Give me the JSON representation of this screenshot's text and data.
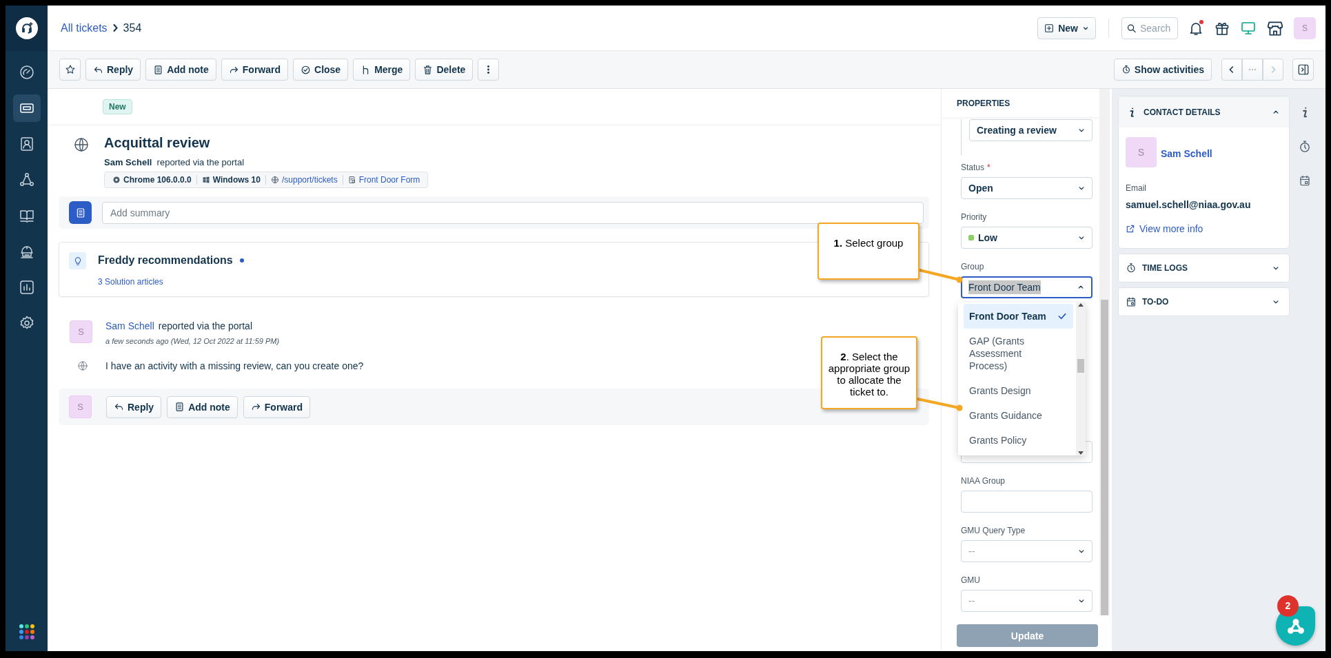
{
  "sidebar": {
    "items": [
      {
        "selected": false
      },
      {
        "selected": true
      },
      {
        "selected": false
      },
      {
        "selected": false
      },
      {
        "selected": false
      },
      {
        "selected": false
      },
      {
        "selected": false
      },
      {
        "selected": false
      }
    ]
  },
  "header": {
    "breadcrumb_link": "All tickets",
    "breadcrumb_current": "354",
    "new_button": "New",
    "search_placeholder": "Search",
    "notifications_unread": true,
    "avatar": "S"
  },
  "toolbar": {
    "buttons": [
      "Reply",
      "Add note",
      "Forward",
      "Close",
      "Merge",
      "Delete"
    ],
    "show_activities": "Show activities"
  },
  "ticket": {
    "status_badge": "New",
    "title": "Acquittal review",
    "requester": "Sam Schell",
    "reported": "reported via the portal",
    "meta": [
      {
        "kind": "plain",
        "text": "Chrome 106.0.0.0"
      },
      {
        "kind": "plain",
        "text": "Windows 10"
      },
      {
        "kind": "link",
        "text": "/support/tickets"
      },
      {
        "kind": "link",
        "text": "Front Door Form"
      }
    ],
    "summary_placeholder": "Add summary"
  },
  "freddy": {
    "title": "Freddy recommendations",
    "link": "3 Solution articles"
  },
  "conversation": {
    "avatar": "S",
    "author": "Sam Schell",
    "via": "reported via the portal",
    "time": "a few seconds ago (Wed, 12 Oct 2022 at 11:59 PM)",
    "body": "I have an activity with a missing review, can you create one?"
  },
  "reply_bar": {
    "avatar": "S",
    "buttons": [
      "Reply",
      "Add note",
      "Forward"
    ]
  },
  "properties": {
    "title": "PROPERTIES",
    "fields": [
      {
        "kind": "nested-select",
        "value": "Creating a review",
        "expanded": false
      },
      {
        "kind": "select",
        "label": "Status",
        "required_mark": "*",
        "value": "Open",
        "expanded": false
      },
      {
        "kind": "select",
        "label": "Priority",
        "value": "Low",
        "color": "#8ccf63",
        "expanded": false
      },
      {
        "kind": "select",
        "label": "Group",
        "value": "Front Door Team",
        "expanded": true,
        "options": [
          {
            "label": "Front Door Team",
            "selected": true
          },
          {
            "label": "GAP (Grants Assessment Process)",
            "selected": false
          },
          {
            "label": "Grants Design",
            "selected": false
          },
          {
            "label": "Grants Guidance",
            "selected": false
          },
          {
            "label": "Grants Policy",
            "selected": false
          }
        ]
      },
      {
        "kind": "covered-input"
      },
      {
        "kind": "input",
        "label": "NIAA Group"
      },
      {
        "kind": "select",
        "label": "GMU Query Type",
        "value": "--",
        "expanded": false
      },
      {
        "kind": "select",
        "label": "GMU",
        "value": "--",
        "expanded": false
      }
    ],
    "update_button": "Update",
    "update_disabled": true
  },
  "contact": {
    "title": "CONTACT DETAILS",
    "expanded": true,
    "avatar": "S",
    "name": "Sam Schell",
    "email_label": "Email",
    "email": "samuel.schell@niaa.gov.au",
    "link": "View more info"
  },
  "widgets": [
    {
      "kind": "time",
      "title": "TIME LOGS",
      "expanded": false
    },
    {
      "kind": "todo",
      "title": "TO-DO",
      "expanded": false
    }
  ],
  "callouts": [
    {
      "text": "**1.** Select group"
    },
    {
      "text": "**2**. Select the appropriate group to allocate the ticket to."
    }
  ],
  "chat_badge": "2"
}
